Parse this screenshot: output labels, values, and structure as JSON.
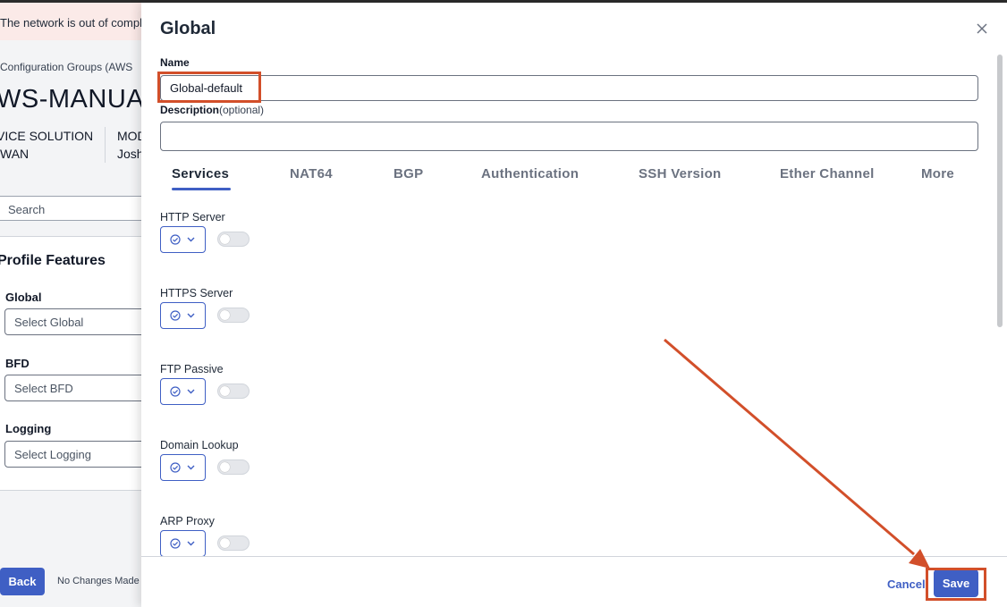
{
  "background": {
    "alert_text": "The network is out of compli",
    "breadcrumb": "Configuration Groups (AWS",
    "page_title": "WS-MANUA",
    "meta": [
      {
        "line1": "VICE SOLUTION",
        "line2": "WAN"
      },
      {
        "line1": "MOD",
        "line2": "Josh"
      }
    ],
    "search_placeholder": "Search",
    "profile_features_title": "Profile Features",
    "features": [
      {
        "label": "Global",
        "placeholder": "Select Global"
      },
      {
        "label": "BFD",
        "placeholder": "Select BFD"
      },
      {
        "label": "Logging",
        "placeholder": "Select Logging"
      }
    ],
    "back_label": "Back",
    "status_text": "No Changes Made"
  },
  "drawer": {
    "title": "Global",
    "name_label": "Name",
    "name_value": "Global-default",
    "description_label": "Description",
    "description_optional": "(optional)",
    "description_value": "",
    "tabs": [
      "Services",
      "NAT64",
      "BGP",
      "Authentication",
      "SSH Version",
      "Ether Channel",
      "More"
    ],
    "active_tab": "Services",
    "services": [
      {
        "label": "HTTP Server",
        "enabled": false
      },
      {
        "label": "HTTPS Server",
        "enabled": false
      },
      {
        "label": "FTP Passive",
        "enabled": false
      },
      {
        "label": "Domain Lookup",
        "enabled": false
      },
      {
        "label": "ARP Proxy",
        "enabled": false
      }
    ],
    "cancel_label": "Cancel",
    "save_label": "Save"
  },
  "colors": {
    "accent": "#3f5fc4",
    "annotation": "#d24f2a",
    "alert_bg": "#fbeae8"
  },
  "icons": {
    "close": "close-icon",
    "variable": "check-circle-icon",
    "dropdown": "chevron-down-icon"
  }
}
